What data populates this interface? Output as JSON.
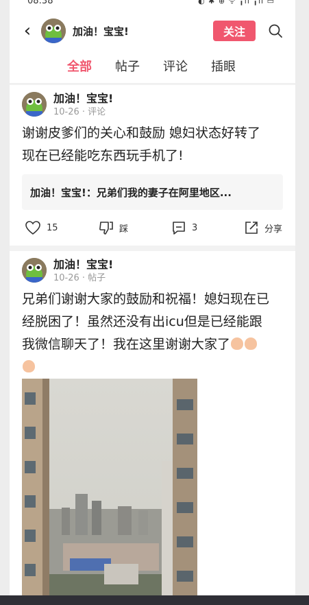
{
  "status": {
    "time": "08:38",
    "icons": "◐ ✱ ⊕ ᯤ ╻ıl ╻ıl ▭"
  },
  "header": {
    "back": "‹",
    "name": "加油！宝宝!",
    "follow": "关注"
  },
  "tabs": [
    "全部",
    "帖子",
    "评论",
    "插眼"
  ],
  "card1": {
    "name": "加油！宝宝!",
    "meta": "10-26 · 评论",
    "text_line1": "谢谢皮爹们的关心和鼓励 媳妇状态好转了",
    "text_line2": "现在已经能吃东西玩手机了!",
    "quote": "加油！宝宝!：兄弟们我的妻子在阿里地区...",
    "likes": "15",
    "dislike": "踩",
    "comments": "3",
    "share": "分享"
  },
  "card2": {
    "name": "加油！宝宝!",
    "meta": "10-26 · 帖子",
    "text_line1": "兄弟们谢谢大家的鼓励和祝福！媳妇现在已",
    "text_line2": "经脱困了！虽然还没有出icu但是已经能跟",
    "text_line3": "我微信聊天了！我在这里谢谢大家了"
  },
  "colors": {
    "accent": "#f0576e"
  },
  "icons": [
    "back-arrow-icon",
    "search-icon",
    "like-icon",
    "dislike-icon",
    "comment-icon",
    "share-icon",
    "praying-hands-emoji"
  ]
}
